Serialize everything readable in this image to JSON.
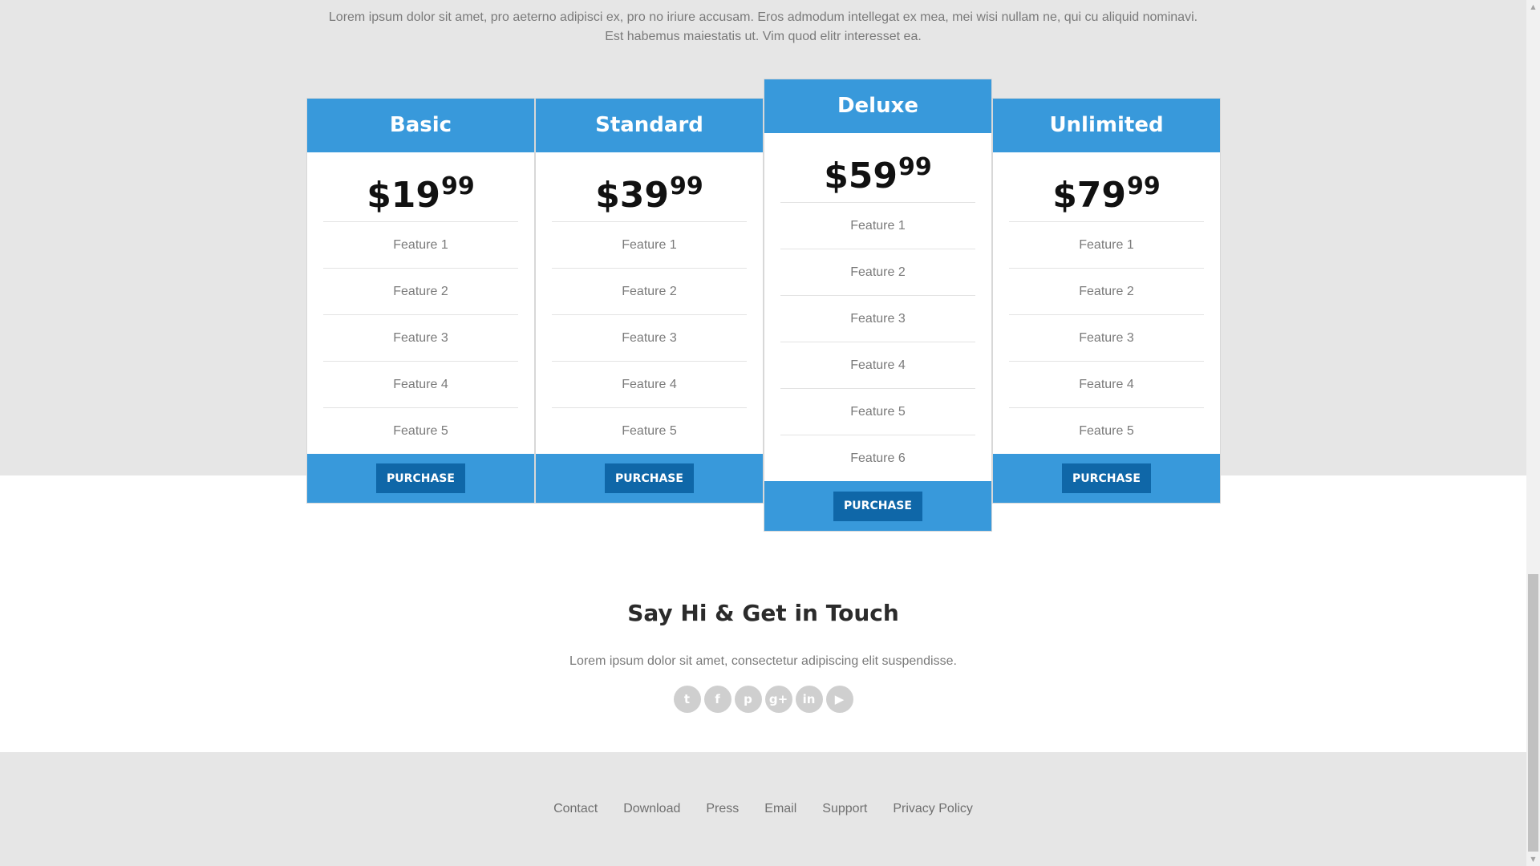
{
  "intro": {
    "line1": "Lorem ipsum dolor sit amet, pro aeterno adipisci ex, pro no iriure accusam. Eros admodum intellegat ex mea, mei wisi nullam ne, qui cu aliquid nominavi.",
    "line2": "Est habemus maiestatis ut. Vim quod elitr interesset ea."
  },
  "plans": [
    {
      "name": "Basic",
      "price": "$19",
      "cents": "99",
      "features": [
        "Feature 1",
        "Feature 2",
        "Feature 3",
        "Feature 4",
        "Feature 5"
      ],
      "button": "PURCHASE"
    },
    {
      "name": "Standard",
      "price": "$39",
      "cents": "99",
      "features": [
        "Feature 1",
        "Feature 2",
        "Feature 3",
        "Feature 4",
        "Feature 5"
      ],
      "button": "PURCHASE"
    },
    {
      "name": "Deluxe",
      "price": "$59",
      "cents": "99",
      "features": [
        "Feature 1",
        "Feature 2",
        "Feature 3",
        "Feature 4",
        "Feature 5",
        "Feature 6"
      ],
      "button": "PURCHASE",
      "featured": true
    },
    {
      "name": "Unlimited",
      "price": "$79",
      "cents": "99",
      "features": [
        "Feature 1",
        "Feature 2",
        "Feature 3",
        "Feature 4",
        "Feature 5"
      ],
      "button": "PURCHASE"
    }
  ],
  "contact": {
    "title": "Say Hi & Get in Touch",
    "subtitle": "Lorem ipsum dolor sit amet, consectetur adipiscing elit suspendisse."
  },
  "social": [
    {
      "icon": "twitter-icon",
      "glyph": "t"
    },
    {
      "icon": "facebook-icon",
      "glyph": "f"
    },
    {
      "icon": "pinterest-icon",
      "glyph": "p"
    },
    {
      "icon": "google-plus-icon",
      "glyph": "g+"
    },
    {
      "icon": "linkedin-icon",
      "glyph": "in"
    },
    {
      "icon": "youtube-icon",
      "glyph": "▶"
    }
  ],
  "footer": {
    "links": [
      "Contact",
      "Download",
      "Press",
      "Email",
      "Support",
      "Privacy Policy"
    ]
  },
  "colors": {
    "accent": "#3899db",
    "button": "#0f67a8",
    "band": "#e6e6e6"
  }
}
